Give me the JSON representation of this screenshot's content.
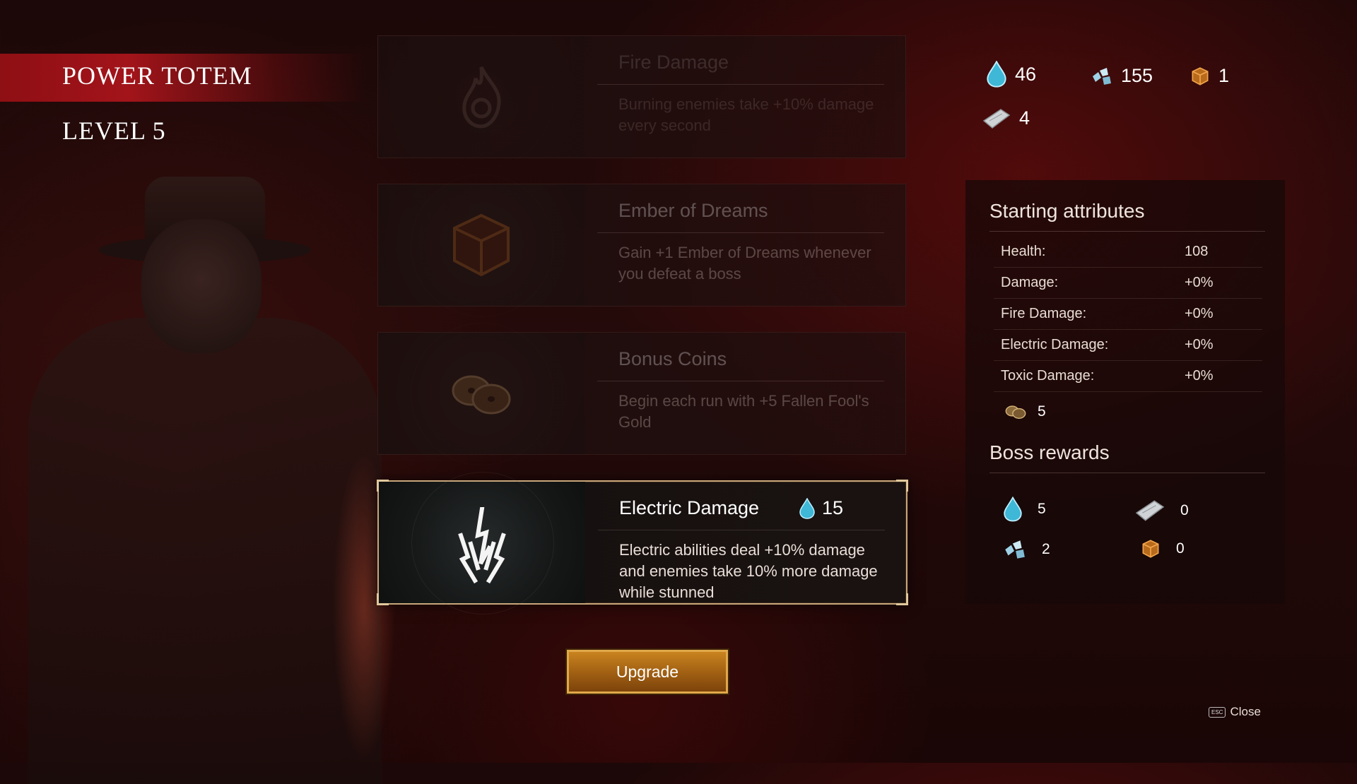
{
  "header": {
    "title": "POWER TOTEM",
    "level": "LEVEL 5"
  },
  "currencies": [
    {
      "icon": "soul-drop-icon",
      "value": "46"
    },
    {
      "icon": "crystal-shards-icon",
      "value": "155"
    },
    {
      "icon": "chest-icon",
      "value": "1"
    },
    {
      "icon": "scroll-icon",
      "value": "4"
    }
  ],
  "upgrades": [
    {
      "name": "Fire Damage",
      "description": "Burning enemies take +10% damage every second",
      "icon": "fire-icon",
      "state": "faint"
    },
    {
      "name": "Ember of Dreams",
      "description": "Gain +1 Ember of Dreams whenever you defeat a boss",
      "icon": "chest-icon",
      "state": "dim"
    },
    {
      "name": "Bonus Coins",
      "description": "Begin each run with +5 Fallen Fool's Gold",
      "icon": "coins-icon",
      "state": "dim"
    },
    {
      "name": "Electric Damage",
      "description": "Electric abilities deal +10% damage and enemies take 10% more damage while stunned",
      "icon": "lightning-icon",
      "state": "selected",
      "cost": "15"
    }
  ],
  "upgrade_button": "Upgrade",
  "starting_attributes": {
    "title": "Starting attributes",
    "rows": [
      {
        "label": "Health:",
        "value": "108"
      },
      {
        "label": "Damage:",
        "value": "+0%"
      },
      {
        "label": "Fire Damage:",
        "value": "+0%"
      },
      {
        "label": "Electric Damage:",
        "value": "+0%"
      },
      {
        "label": "Toxic Damage:",
        "value": "+0%"
      }
    ],
    "coins": "5"
  },
  "boss_rewards": {
    "title": "Boss rewards",
    "items": [
      {
        "icon": "soul-drop-icon",
        "value": "5"
      },
      {
        "icon": "scroll-icon",
        "value": "0"
      },
      {
        "icon": "crystal-shards-icon",
        "value": "2"
      },
      {
        "icon": "chest-icon",
        "value": "0"
      }
    ]
  },
  "close": {
    "key": "ESC",
    "label": "Close"
  },
  "colors": {
    "accent_red": "#a2141a",
    "button_gold": "#c9831f",
    "drop_blue": "#3fb7d6"
  }
}
